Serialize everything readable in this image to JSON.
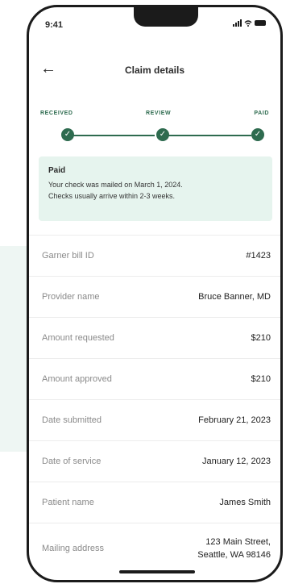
{
  "status_bar": {
    "time": "9:41"
  },
  "header": {
    "back_icon": "arrow-left-icon",
    "title": "Claim details"
  },
  "progress": {
    "steps": [
      {
        "label": "RECEIVED",
        "complete": true
      },
      {
        "label": "REVIEW",
        "complete": true
      },
      {
        "label": "PAID",
        "complete": true
      }
    ],
    "check_glyph": "✓",
    "accent": "#2e6b4f"
  },
  "alert": {
    "title": "Paid",
    "line1": "Your check was mailed on March 1, 2024.",
    "line2": "Checks usually arrive within 2-3 weeks.",
    "background": "#e6f4ee"
  },
  "details": [
    {
      "label": "Garner bill ID",
      "value": "#1423"
    },
    {
      "label": "Provider name",
      "value": "Bruce Banner, MD"
    },
    {
      "label": "Amount requested",
      "value": "$210"
    },
    {
      "label": "Amount approved",
      "value": "$210"
    },
    {
      "label": "Date submitted",
      "value": "February 21, 2023"
    },
    {
      "label": "Date of service",
      "value": "January 12, 2023"
    },
    {
      "label": "Patient name",
      "value": "James Smith"
    },
    {
      "label": "Mailing address",
      "value_line1": "123 Main Street,",
      "value_line2": "Seattle, WA 98146"
    }
  ]
}
